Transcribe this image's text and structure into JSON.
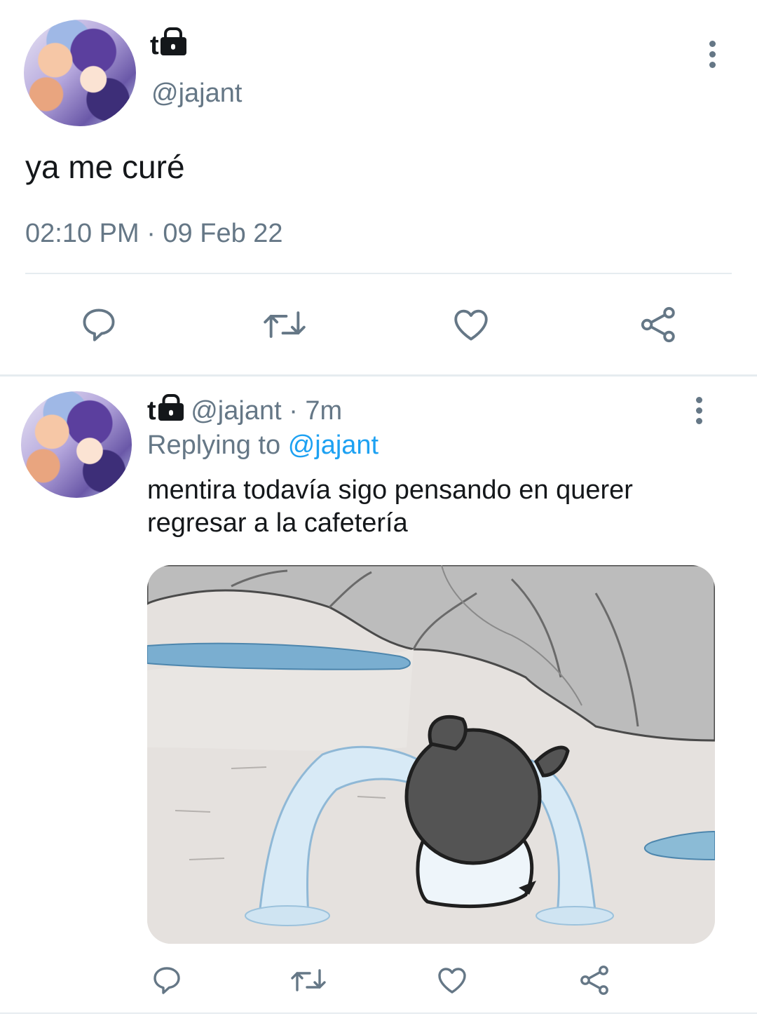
{
  "main_tweet": {
    "display_name": "t",
    "handle": "@jajant",
    "text": "ya me curé",
    "timestamp": "02:10 PM · 09 Feb 22"
  },
  "reply_tweet": {
    "display_name": "t",
    "handle": "@jajant",
    "separator": "·",
    "time_ago": "7m",
    "replying_prefix": "Replying to",
    "replying_to": "@jajant",
    "text_line1": "mentira todavía sigo pensando en querer",
    "text_line2": "regresar a la cafetería"
  },
  "icons": {
    "lock": "lock-icon",
    "more": "more-vertical-icon",
    "reply": "reply-icon",
    "retweet": "retweet-icon",
    "like": "heart-icon",
    "share": "share-icon"
  },
  "colors": {
    "text": "#14171a",
    "muted": "#657786",
    "link": "#1da1f2",
    "divider": "#e6ecf0"
  }
}
